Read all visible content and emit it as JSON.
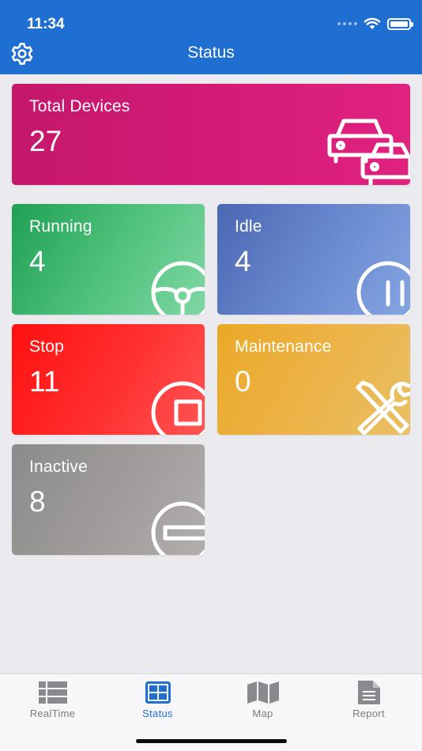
{
  "status_bar": {
    "time": "11:34"
  },
  "header": {
    "title": "Status"
  },
  "cards": {
    "total": {
      "label": "Total Devices",
      "value": "27",
      "icon": "cars-icon"
    },
    "running": {
      "label": "Running",
      "value": "4",
      "icon": "steering-wheel-icon"
    },
    "idle": {
      "label": "Idle",
      "value": "4",
      "icon": "pause-icon"
    },
    "stop": {
      "label": "Stop",
      "value": "11",
      "icon": "stop-icon"
    },
    "maintenance": {
      "label": "Maintenance",
      "value": "0",
      "icon": "tools-icon"
    },
    "inactive": {
      "label": "Inactive",
      "value": "8",
      "icon": "minus-icon"
    }
  },
  "colors": {
    "header": "#1f6fd3",
    "total": "#d41b78",
    "running": "#2aa660",
    "idle": "#5f7fc6",
    "stop": "#ff1e1e",
    "maintenance": "#ebae38",
    "inactive": "#9a9796",
    "tab_active": "#1f6fd3",
    "tab_inactive": "#7b7b80"
  },
  "tabs": [
    {
      "label": "RealTime",
      "icon": "list-icon",
      "active": false
    },
    {
      "label": "Status",
      "icon": "grid-icon",
      "active": true
    },
    {
      "label": "Map",
      "icon": "map-icon",
      "active": false
    },
    {
      "label": "Report",
      "icon": "document-icon",
      "active": false
    }
  ]
}
